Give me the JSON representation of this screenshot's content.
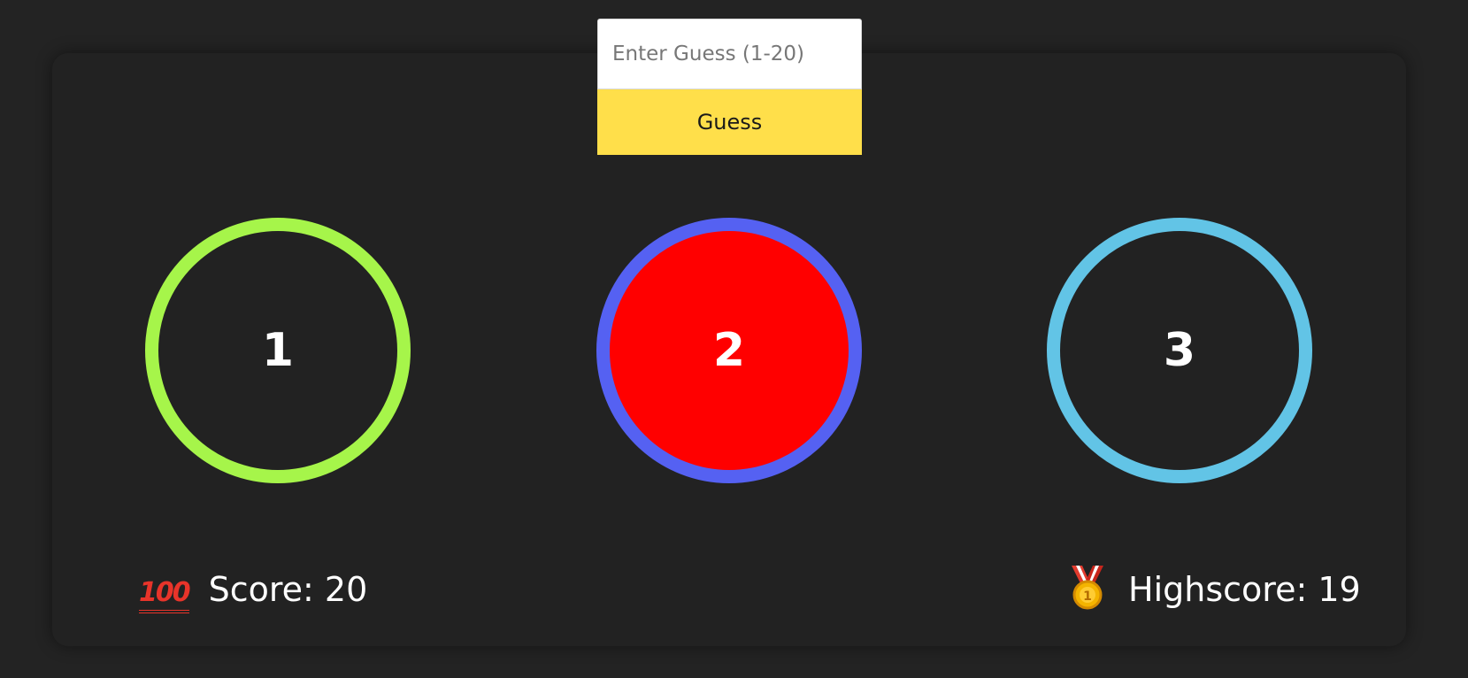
{
  "guess": {
    "input_value": "",
    "input_placeholder": "Enter Guess (1-20)",
    "button_label": "Guess"
  },
  "circles": [
    {
      "label": "1",
      "border_color": "#a6f54a",
      "fill_color": "transparent"
    },
    {
      "label": "2",
      "border_color": "#5561f2",
      "fill_color": "#ff0000"
    },
    {
      "label": "3",
      "border_color": "#62c4e6",
      "fill_color": "transparent"
    }
  ],
  "score": {
    "icon": "hundred-points-icon",
    "text": "Score: 20"
  },
  "highscore": {
    "icon": "medal-icon",
    "text": "Highscore: 19"
  },
  "colors": {
    "background": "#232323",
    "panel": "#222222",
    "button": "#ffdf4a"
  }
}
